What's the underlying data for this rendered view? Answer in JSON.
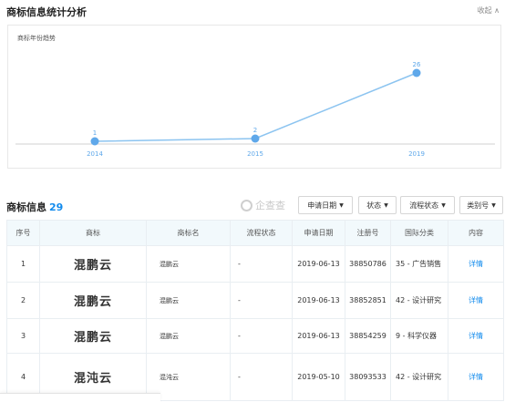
{
  "section": {
    "title": "商标信息统计分析",
    "collapse_label": "收起"
  },
  "chart_data": {
    "type": "line",
    "title": "商标年份趋势",
    "x": [
      "2014",
      "2015",
      "2019"
    ],
    "values": [
      1,
      2,
      26
    ],
    "data_labels": [
      "1",
      "2",
      "26"
    ],
    "ylim": [
      0,
      30
    ],
    "grid": false,
    "colors": {
      "line": "#8cc4f0",
      "point": "#5fa8ea",
      "label": "#5fa8ea",
      "axis": "#d0d0d0"
    }
  },
  "trademarks": {
    "title": "商标信息",
    "count": "29",
    "watermark": "企查查",
    "filters": [
      "申请日期",
      "状态",
      "流程状态",
      "类别号"
    ],
    "columns": [
      "序号",
      "商标",
      "商标名",
      "流程状态",
      "申请日期",
      "注册号",
      "国际分类",
      "内容"
    ],
    "rows": [
      {
        "index": "1",
        "mark": "混鹏云",
        "name": "混鹏云",
        "status": "-",
        "date": "2019-06-13",
        "reg_no": "38850786",
        "class": "35 - 广告销售",
        "detail": "详情"
      },
      {
        "index": "2",
        "mark": "混鹏云",
        "name": "混鹏云",
        "status": "-",
        "date": "2019-06-13",
        "reg_no": "38852851",
        "class": "42 - 设计研究",
        "detail": "详情"
      },
      {
        "index": "3",
        "mark": "混鹏云",
        "name": "混鹏云",
        "status": "-",
        "date": "2019-06-13",
        "reg_no": "38854259",
        "class": "9 - 科学仪器",
        "detail": "详情"
      },
      {
        "index": "4",
        "mark": "混沌云",
        "name": "混沌云",
        "status": "-",
        "date": "2019-05-10",
        "reg_no": "38093533",
        "class": "42 - 设计研究",
        "detail": "详情"
      }
    ]
  }
}
